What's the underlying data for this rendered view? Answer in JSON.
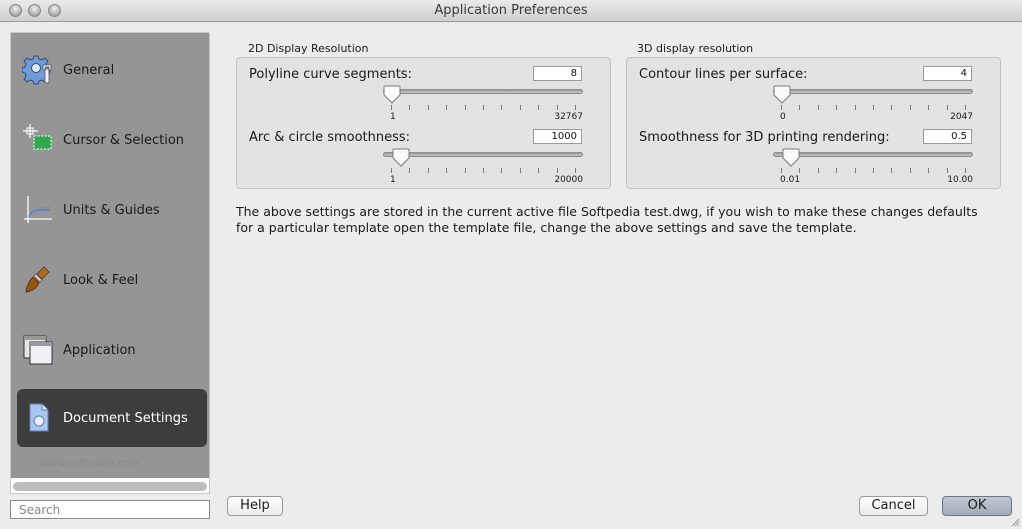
{
  "window": {
    "title": "Application Preferences",
    "traffic_lights": [
      "close-button",
      "minimize-button",
      "zoom-button"
    ]
  },
  "sidebar": {
    "items": [
      {
        "label": "General",
        "icon": "gear-wrench-icon",
        "selected": false
      },
      {
        "label": "Cursor & Selection",
        "icon": "crosshair-selection-icon",
        "selected": false
      },
      {
        "label": "Units & Guides",
        "icon": "ruler-axis-icon",
        "selected": false
      },
      {
        "label": "Look & Feel",
        "icon": "paintbrush-icon",
        "selected": false
      },
      {
        "label": "Application",
        "icon": "windows-icon",
        "selected": false
      },
      {
        "label": "Document Settings",
        "icon": "document-icon",
        "selected": true
      }
    ],
    "watermark": "www.softpedia.com",
    "search_placeholder": "Search"
  },
  "group_2d": {
    "title": "2D Display Resolution",
    "rows": [
      {
        "label": "Polyline curve segments:",
        "value": "8",
        "min_label": "1",
        "max_label": "32767",
        "fraction": 0.0
      },
      {
        "label": "Arc & circle smoothness:",
        "value": "1000",
        "min_label": "1",
        "max_label": "20000",
        "fraction": 0.05
      }
    ]
  },
  "group_3d": {
    "title": "3D display resolution",
    "rows": [
      {
        "label": "Contour lines per surface:",
        "value": "4",
        "min_label": "0",
        "max_label": "2047",
        "fraction": 0.0
      },
      {
        "label": "Smoothness for 3D printing rendering:",
        "value": "0.5",
        "min_label": "0.01",
        "max_label": "10.00",
        "fraction": 0.05
      }
    ]
  },
  "info_text": "The above settings are stored in the current active file Softpedia test.dwg, if you wish to make these changes defaults for a particular template open the template file, change the above settings and save the template.",
  "buttons": {
    "help": "Help",
    "cancel": "Cancel",
    "ok": "OK"
  }
}
